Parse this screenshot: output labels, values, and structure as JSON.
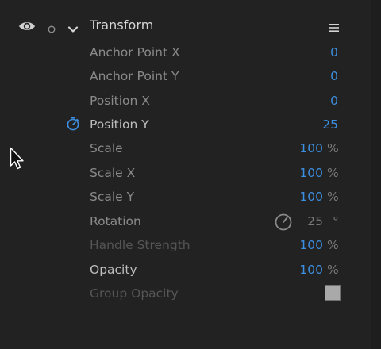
{
  "header": {
    "title": "Transform",
    "eye_icon": "eye-icon",
    "solo_icon": "circle-icon",
    "chevron_icon": "chevron-down-icon",
    "menu_icon": "hamburger-menu-icon"
  },
  "rows": [
    {
      "label": "Anchor Point X",
      "value": "0",
      "unit": ""
    },
    {
      "label": "Anchor Point Y",
      "value": "0",
      "unit": ""
    },
    {
      "label": "Position X",
      "value": "0",
      "unit": ""
    },
    {
      "label": "Position Y",
      "value": "25",
      "unit": "",
      "keyframe_icon": "stopwatch-icon"
    },
    {
      "label": "Scale",
      "value": "100",
      "unit": "%"
    },
    {
      "label": "Scale X",
      "value": "100",
      "unit": "%"
    },
    {
      "label": "Scale Y",
      "value": "100",
      "unit": "%"
    },
    {
      "label": "Rotation",
      "value": "25",
      "unit": "°",
      "dial_icon": "rotation-dial-icon"
    },
    {
      "label": "Handle Strength",
      "value": "100",
      "unit": "%"
    },
    {
      "label": "Opacity",
      "value": "100",
      "unit": "%"
    },
    {
      "label": "Group Opacity",
      "value": "",
      "unit": "",
      "swatch_color": "#a9a9a9"
    }
  ],
  "colors": {
    "accent": "#3d8fe0",
    "background": "#222222"
  },
  "cursor_icon": "mouse-pointer-icon"
}
